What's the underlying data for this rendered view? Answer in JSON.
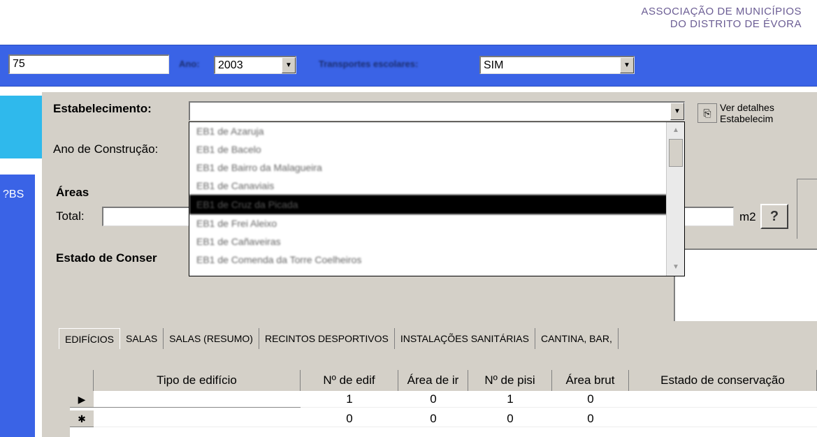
{
  "header": {
    "org_line1": "ASSOCIAÇÃO DE MUNICÍPIOS",
    "org_line2": "DO DISTRITO DE ÉVORA"
  },
  "filter_bar": {
    "id_value": "75",
    "ano_label": "Ano:",
    "ano_value": "2003",
    "transportes_label": "Transportes escolares:",
    "transportes_value": "SIM"
  },
  "form": {
    "estabelecimento_label": "Estabelecimento:",
    "ver_detalhes_line1": "Ver detalhes",
    "ver_detalhes_line2": "Estabelecim",
    "ano_construcao_label": "Ano de Construção:",
    "areas_title": "Áreas",
    "total_label": "Total:",
    "unit_m2": "m2",
    "help_glyph": "?",
    "estado_label": "Estado de Conser",
    "left_side_text": "?BS"
  },
  "dropdown": {
    "items": [
      "EB1 de Azaruja",
      "EB1 de Bacelo",
      "EB1 de Bairro da Malagueira",
      "EB1 de Canaviais",
      "EB1 de Cruz da Picada",
      "EB1 de Frei Aleixo",
      "EB1 de Cañaveiras",
      "EB1 de Comenda da Torre Coelheiros"
    ],
    "selected_index": 4
  },
  "tabs": [
    "EDIFÍCIOS",
    "SALAS",
    "SALAS (RESUMO)",
    "RECINTOS DESPORTIVOS",
    "INSTALAÇÕES SANITÁRIAS",
    "CANTINA, BAR,"
  ],
  "grid": {
    "columns": [
      "Tipo de edifício",
      "Nº de edif",
      "Área de ir",
      "Nº de pisi",
      "Área brut",
      "Estado de conservação"
    ],
    "rows": [
      {
        "selector": "▶",
        "values": [
          "",
          "1",
          "0",
          "1",
          "0",
          ""
        ]
      },
      {
        "selector": "✱",
        "values": [
          "",
          "0",
          "0",
          "0",
          "0",
          ""
        ]
      }
    ]
  }
}
